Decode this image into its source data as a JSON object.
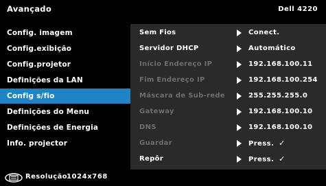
{
  "header": {
    "title": "Avançado",
    "model": "Dell 4220"
  },
  "menu": [
    {
      "label": "Config. imagem",
      "selected": false
    },
    {
      "label": "Config.exibição",
      "selected": false
    },
    {
      "label": "Config.projetor",
      "selected": false
    },
    {
      "label": "Definições da LAN",
      "selected": false
    },
    {
      "label": "Config s/fio",
      "selected": true
    },
    {
      "label": "Definições do Menu",
      "selected": false
    },
    {
      "label": "Definições de Energia",
      "selected": false
    },
    {
      "label": "Info. projector",
      "selected": false
    }
  ],
  "settings": [
    {
      "label": "Sem Fios",
      "value": "Conect.",
      "enabled": true,
      "check": ""
    },
    {
      "label": "Servidor DHCP",
      "value": "Automático",
      "enabled": true,
      "check": ""
    },
    {
      "label": "Início Endereço IP",
      "value": "192.168.100.11",
      "enabled": false,
      "check": ""
    },
    {
      "label": "Fim Endereço IP",
      "value": "192.168.100.254",
      "enabled": false,
      "check": ""
    },
    {
      "label": "Máscara de Sub-rede",
      "value": "255.255.255.0",
      "enabled": false,
      "check": ""
    },
    {
      "label": "Gateway",
      "value": "192.168.100.10",
      "enabled": false,
      "check": ""
    },
    {
      "label": "DNS",
      "value": "192.168.100.10",
      "enabled": false,
      "check": ""
    },
    {
      "label": "Guardar",
      "value": "Press.",
      "enabled": false,
      "check": "✓"
    },
    {
      "label": "Repôr",
      "value": "Press.",
      "enabled": true,
      "check": "✓"
    }
  ],
  "footer": {
    "resolution_label": "Resolução",
    "resolution_value": "1024x768",
    "icon": "source-monitor-icon"
  },
  "colors": {
    "selected": "#1e84c6",
    "panel": "#2a2a2a",
    "disabled_text": "#6e6e6e"
  }
}
